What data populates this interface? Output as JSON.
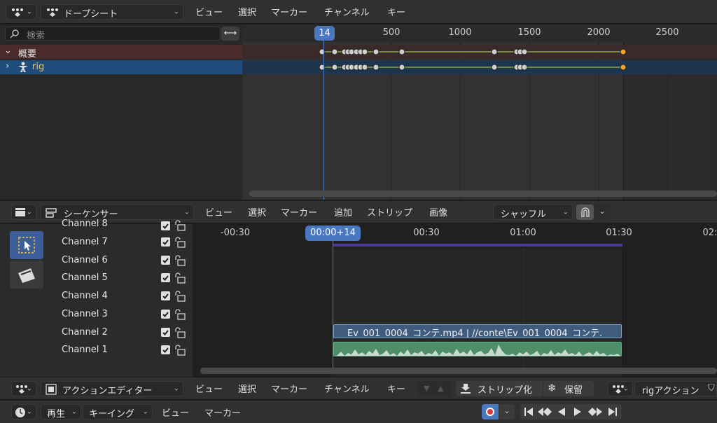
{
  "dopesheet": {
    "editor_type": "ドープシート",
    "menu": [
      "ビュー",
      "選択",
      "マーカー",
      "チャンネル",
      "キー"
    ],
    "search_placeholder": "検索",
    "current_frame": "14",
    "ticks": [
      "500",
      "1000",
      "1500",
      "2000",
      "2500"
    ],
    "channels": [
      {
        "label": "概要",
        "expanded": true
      },
      {
        "label": "rig",
        "expanded": false
      }
    ],
    "colors": {
      "summary_row": "#4a2a2a",
      "rig_row": "#1f4e7d",
      "playhead": "#5680c2",
      "keyframe_selected": "#f5a623"
    }
  },
  "sequencer": {
    "editor_type": "シーケンサー",
    "menu": [
      "ビュー",
      "選択",
      "マーカー",
      "追加",
      "ストリップ",
      "画像"
    ],
    "snap_mode": "シャッフル",
    "current_time": "00:00+14",
    "ticks": [
      "-00:30",
      "00:30",
      "01:00",
      "01:30",
      "02:"
    ],
    "channels": [
      "Channel 8",
      "Channel 7",
      "Channel 6",
      "Channel 5",
      "Channel 4",
      "Channel 3",
      "Channel 2",
      "Channel 1"
    ],
    "strip_movie_label": "Ev_001_0004_コンテ.mp4 | //conte\\Ev_001_0004_コンテ.",
    "colors": {
      "movie_strip": "#3f5c7f",
      "sound_strip": "#4e8f6a",
      "range_bar": "#4b3b9a"
    }
  },
  "action_editor": {
    "editor_type": "アクションエディター",
    "menu": [
      "ビュー",
      "選択",
      "マーカー",
      "チャンネル",
      "キー"
    ],
    "stash_label": "ストリップ化",
    "push_label": "保留",
    "action_name": "rigアクション"
  },
  "timeline": {
    "playback": "再生",
    "keying": "キーイング",
    "menu": [
      "ビュー",
      "マーカー"
    ]
  }
}
